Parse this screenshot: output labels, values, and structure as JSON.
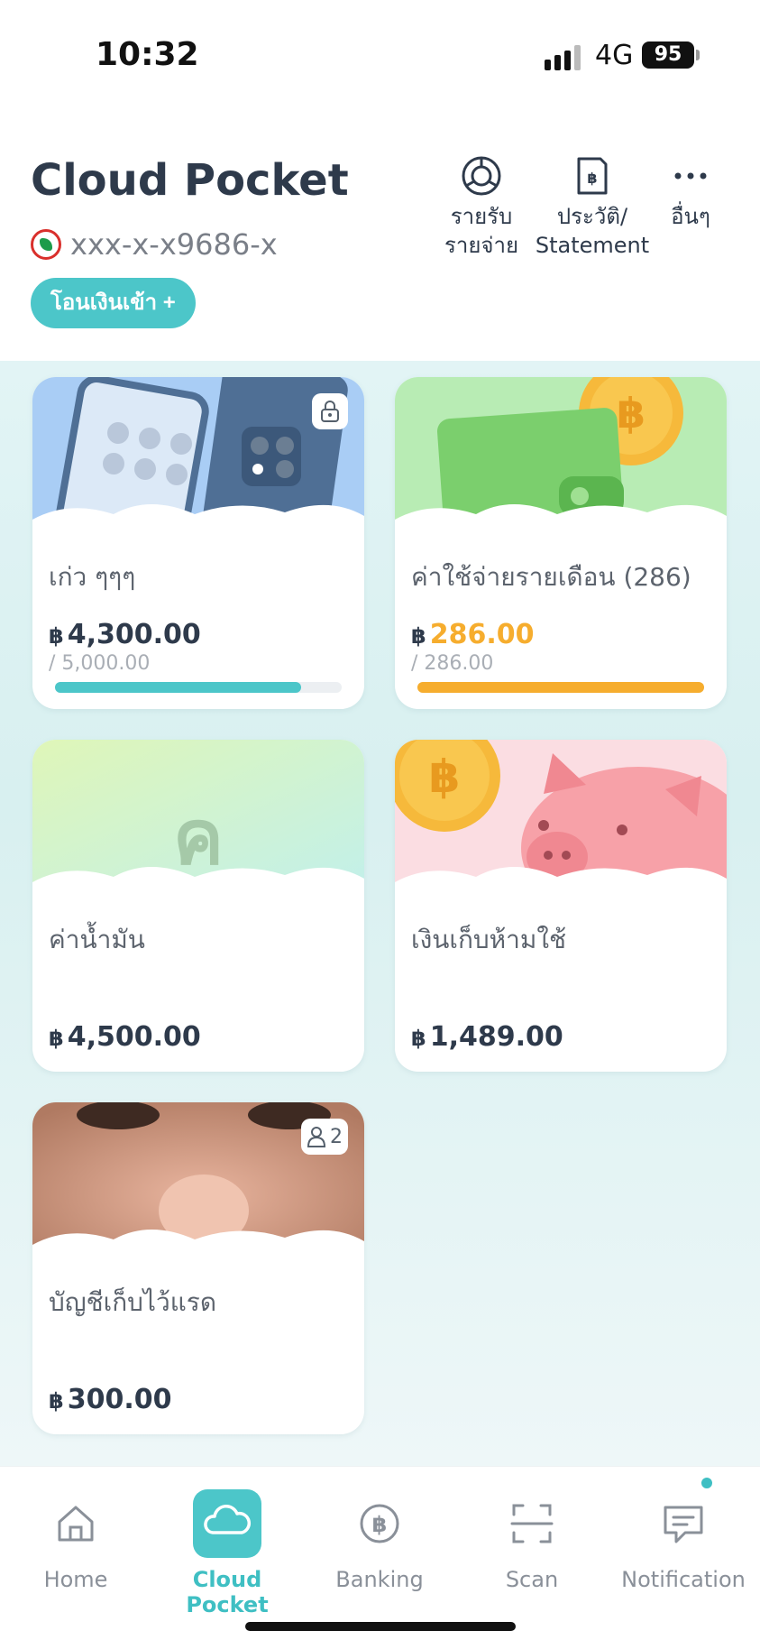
{
  "status_bar": {
    "time": "10:32",
    "network": "4G",
    "battery": "95"
  },
  "header": {
    "title": "Cloud Pocket",
    "account_number": "xxx-x-x9686-x",
    "transfer_label": "โอนเงินเข้า +",
    "actions": [
      {
        "label_line1": "รายรับ",
        "label_line2": "รายจ่าย",
        "icon": "pie-chart-icon"
      },
      {
        "label_line1": "ประวัติ/",
        "label_line2": "Statement",
        "icon": "statement-icon"
      },
      {
        "label_line1": "อื่นๆ",
        "label_line2": "",
        "icon": "more-icon"
      }
    ]
  },
  "pockets": [
    {
      "name": "เก่ว ๆๆๆ",
      "currency": "฿",
      "amount": "4,300.00",
      "target": "/ 5,000.00",
      "progress": 0.86,
      "badge": "lock-icon",
      "accent": "#4cc6c9"
    },
    {
      "name": "ค่าใช้จ่ายรายเดือน (286)",
      "currency": "฿",
      "amount": "286.00",
      "target": "/ 286.00",
      "progress": 1.0,
      "accent": "#f6ad2e"
    },
    {
      "name": "ค่าน้ำมัน",
      "currency": "฿",
      "amount": "4,500.00",
      "art_letter": "ค"
    },
    {
      "name": "เงินเก็บห้ามใช้",
      "currency": "฿",
      "amount": "1,489.00"
    },
    {
      "name": "บัญชีเก็บไว้แรด",
      "currency": "฿",
      "amount": "300.00",
      "members": "2"
    }
  ],
  "nav": [
    {
      "label": "Home",
      "icon": "home-icon"
    },
    {
      "label": "Cloud Pocket",
      "icon": "cloud-icon"
    },
    {
      "label": "Banking",
      "icon": "baht-coin-icon"
    },
    {
      "label": "Scan",
      "icon": "scan-icon"
    },
    {
      "label": "Notification",
      "icon": "chat-bubble-icon"
    }
  ],
  "colors": {
    "brand": "#4cc6c9",
    "accent_orange": "#f6ad2e",
    "title": "#2e3a4b"
  }
}
